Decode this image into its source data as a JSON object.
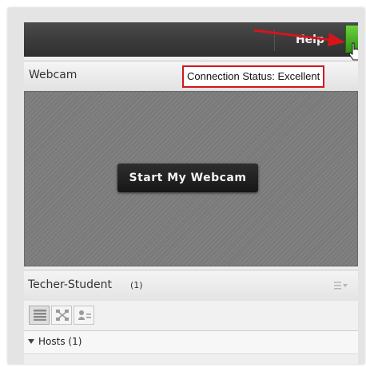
{
  "topbar": {
    "help_label": "Help"
  },
  "webcam": {
    "title": "Webcam",
    "connection_status": "Connection Status: Excellent",
    "start_button_label": "Start My Webcam"
  },
  "attendees": {
    "title": "Techer-Student",
    "count": "(1)",
    "hosts_label": "Hosts (1)"
  },
  "icons": {
    "help": "help-icon",
    "menu": "menu-icon",
    "list_view": "list-view-icon",
    "grid_view": "grid-view-icon",
    "user_view": "user-view-icon",
    "expand": "triangle-down-icon"
  },
  "colors": {
    "annotation_red": "#d4151c",
    "status_green": "#3aa11c",
    "topbar_dark": "#3a3a3a"
  }
}
